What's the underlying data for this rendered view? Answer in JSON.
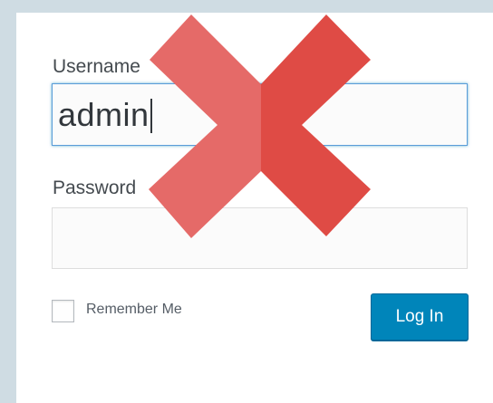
{
  "form": {
    "username_label": "Username",
    "username_value": "admin",
    "password_label": "Password",
    "password_value": "",
    "remember_label": "Remember Me",
    "remember_checked": false,
    "login_button_label": "Log In"
  },
  "overlay": {
    "icon": "x-mark-icon",
    "color_light": "#e56a68",
    "color_dark": "#df4b45"
  },
  "colors": {
    "page_background": "#cfdce3",
    "button": "#0085ba",
    "focus_border": "#5b9dd9"
  }
}
